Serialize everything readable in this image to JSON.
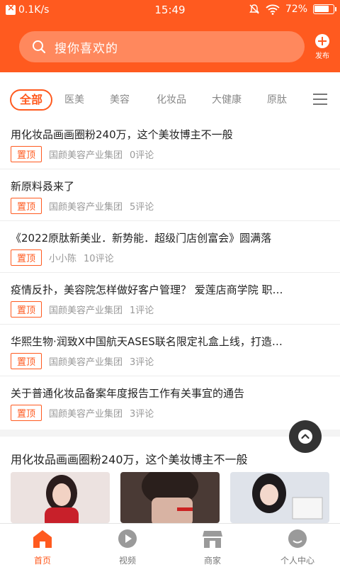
{
  "status_bar": {
    "speed": "0.1K/s",
    "time": "15:49",
    "battery": "72%"
  },
  "header": {
    "search_placeholder": "搜你喜欢的",
    "publish_label": "发布"
  },
  "tabs": [
    {
      "label": "全部",
      "active": true
    },
    {
      "label": "医美"
    },
    {
      "label": "美容"
    },
    {
      "label": "化妆品"
    },
    {
      "label": "大健康"
    },
    {
      "label": "原肽"
    }
  ],
  "articles": [
    {
      "title": "用化妆品画画圈粉240万，这个美妆博主不一般",
      "tag": "置顶",
      "author": "国颜美容产业集团",
      "comments": "0评论"
    },
    {
      "title": "新原料叒来了",
      "tag": "置顶",
      "author": "国颜美容产业集团",
      "comments": "5评论"
    },
    {
      "title": "《2022原肽新美业．新势能．超级门店创富会》圆满落",
      "tag": "置顶",
      "author": "小小陈",
      "comments": "10评论"
    },
    {
      "title": "疫情反扑，美容院怎样做好客户管理？ 爱莲店商学院 职…",
      "tag": "置顶",
      "author": "国颜美容产业集团",
      "comments": "1评论"
    },
    {
      "title": "华熙生物·润致X中国航天ASES联名限定礼盒上线，打造…",
      "tag": "置顶",
      "author": "国颜美容产业集团",
      "comments": "3评论"
    },
    {
      "title": "关于普通化妆品备案年度报告工作有关事宜的通告",
      "tag": "置顶",
      "author": "国颜美容产业集团",
      "comments": "3评论"
    }
  ],
  "featured": {
    "title": "用化妆品画画圈粉240万，这个美妆博主不一般"
  },
  "bottom_nav": [
    {
      "label": "首页",
      "icon": "home-icon",
      "active": true
    },
    {
      "label": "视频",
      "icon": "play-icon"
    },
    {
      "label": "商家",
      "icon": "shop-icon"
    },
    {
      "label": "个人中心",
      "icon": "user-icon"
    }
  ],
  "colors": {
    "brand": "#ff5a1f",
    "text": "#222222",
    "muted": "#999999"
  }
}
